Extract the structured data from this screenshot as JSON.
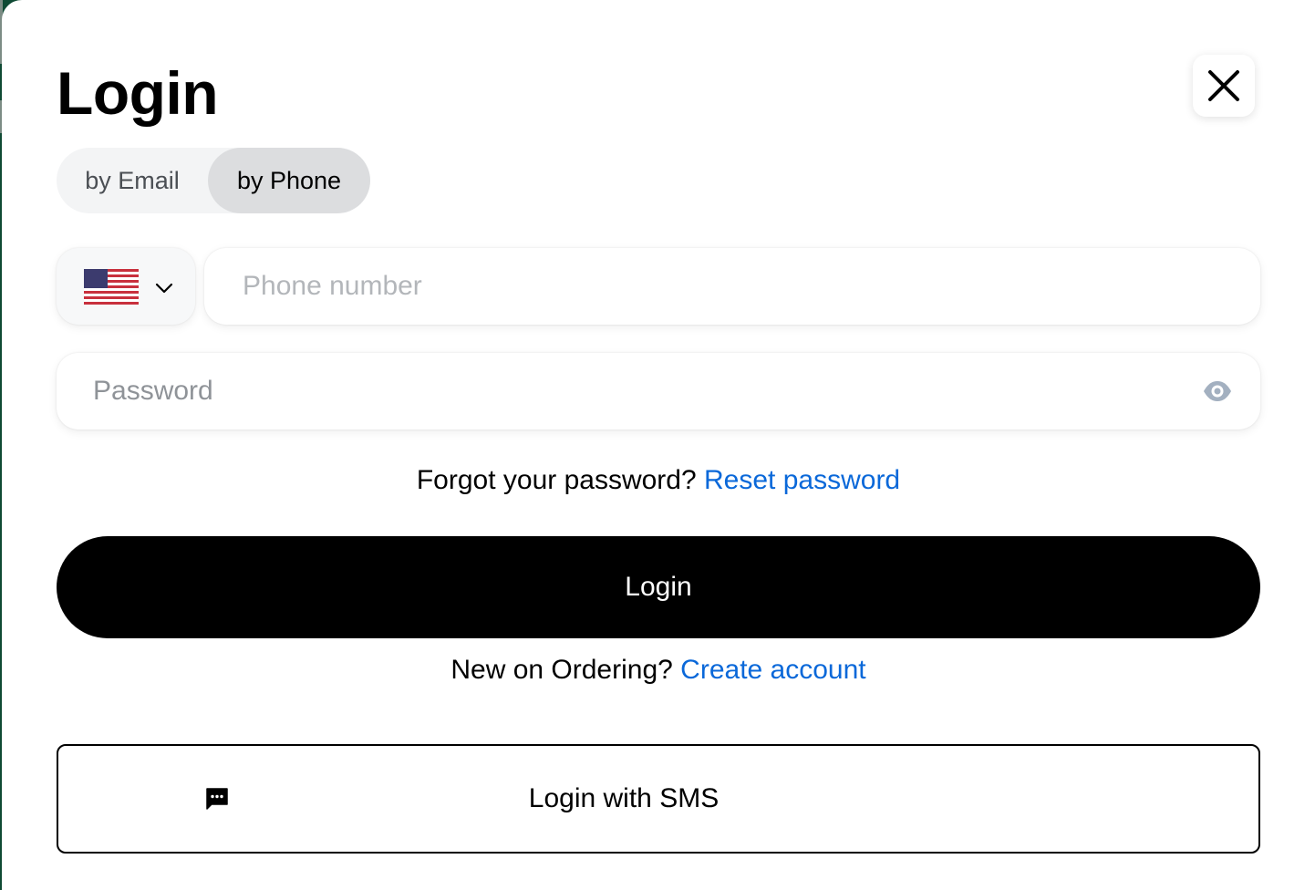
{
  "modal": {
    "title": "Login",
    "close_icon": "close-icon"
  },
  "tabs": [
    {
      "label": "by Email",
      "active": false
    },
    {
      "label": "by Phone",
      "active": true
    }
  ],
  "form": {
    "country": {
      "flag": "us-flag-icon",
      "dropdown_icon": "chevron-down-icon"
    },
    "phone": {
      "value": "",
      "placeholder": "Phone number"
    },
    "password": {
      "value": "",
      "placeholder": "Password",
      "toggle_icon": "eye-icon"
    }
  },
  "forgot": {
    "text": "Forgot your password?",
    "link": "Reset password"
  },
  "login_button": "Login",
  "signup": {
    "text": "New on Ordering?",
    "link": "Create account"
  },
  "sms_button": {
    "label": "Login with SMS",
    "icon": "message-icon"
  },
  "colors": {
    "link": "#0a68d9",
    "primary_button": "#000000",
    "active_tab": "#dcdddf"
  }
}
